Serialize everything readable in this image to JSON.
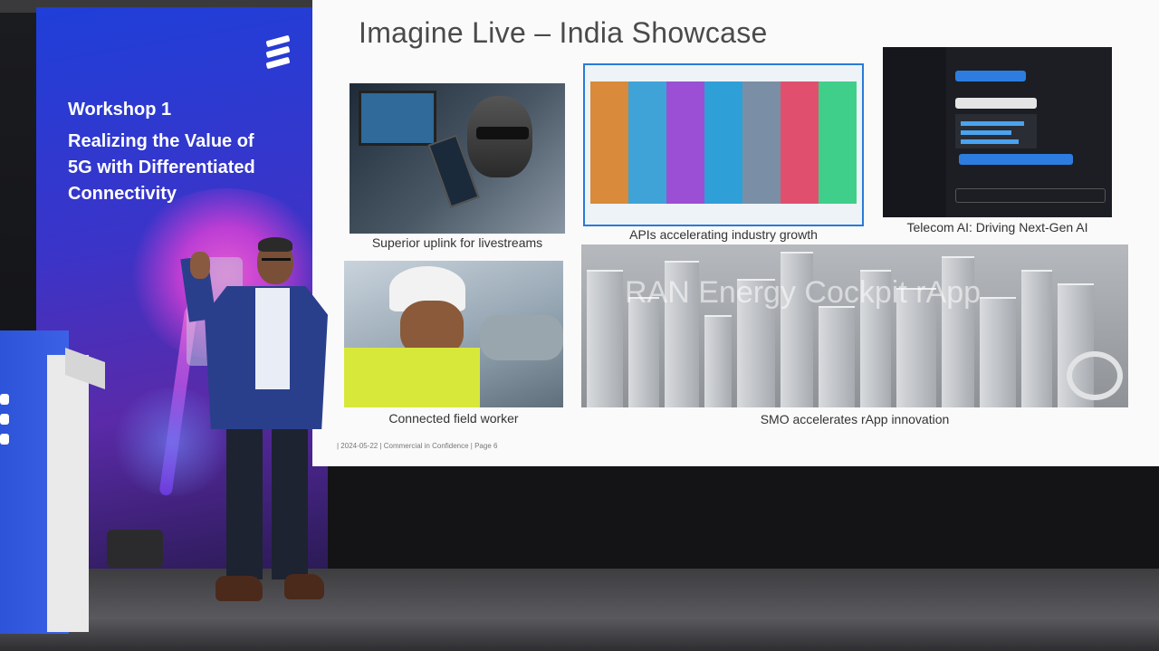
{
  "banner": {
    "line1": "Workshop 1",
    "line2": "Realizing the Value of",
    "line3": "5G with Differentiated",
    "line4": "Connectivity"
  },
  "slide": {
    "title": "Imagine Live – India Showcase",
    "footer": "| 2024-05-22 | Commercial in Confidence | Page 6",
    "panels": [
      {
        "caption": "Superior uplink for livestreams"
      },
      {
        "caption": "APIs accelerating industry growth"
      },
      {
        "caption": "Telecom AI: Driving Next-Gen AI"
      },
      {
        "caption": "Connected field worker"
      },
      {
        "caption": "SMO accelerates rApp innovation",
        "overlay_title": "RAN Energy Cockpit rApp"
      }
    ]
  },
  "colors": {
    "banner_blue": "#1f3fd8",
    "screen_bg": "#fafafa",
    "api_frame": "#2a7ad8",
    "ai_panel": "#1c1e24"
  }
}
